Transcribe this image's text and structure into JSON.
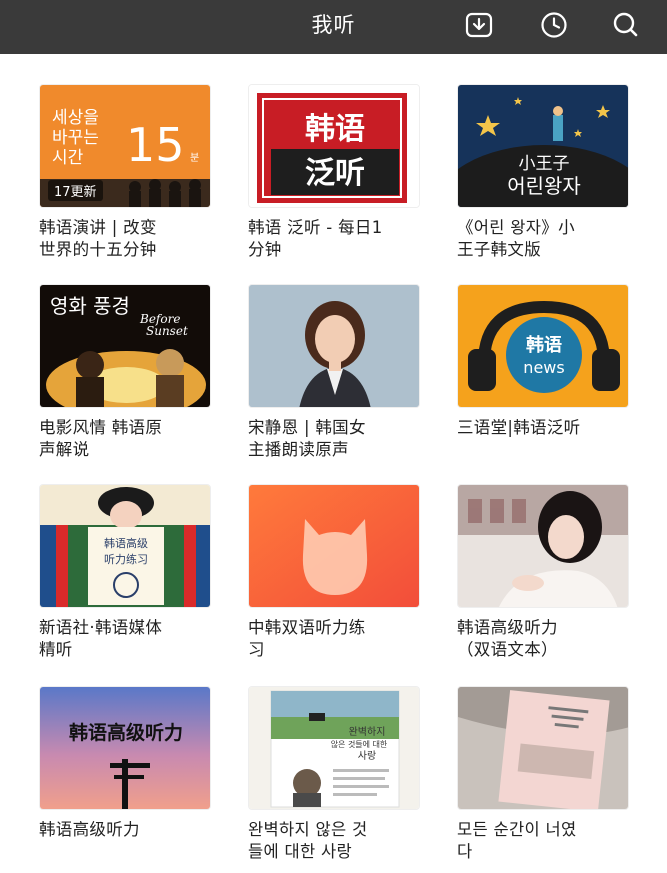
{
  "header": {
    "title": "我听",
    "icons": [
      "download-icon",
      "history-icon",
      "search-icon"
    ],
    "background": "#3a3a3a"
  },
  "items": [
    {
      "title": "韩语演讲 | 改变\n世界的十五分钟",
      "badge": "17更新",
      "cover_text": [
        "세상을",
        "바꾸는",
        "시간",
        "15",
        "분"
      ]
    },
    {
      "title": "韩语 泛听 - 每日1\n分钟",
      "cover_text": [
        "韩语",
        "泛听"
      ]
    },
    {
      "title": "《어린 왕자》小\n王子韩文版",
      "cover_text": [
        "小王子",
        "어린왕자"
      ]
    },
    {
      "title": "电影风情 韩语原\n声解说",
      "cover_text": [
        "영화 풍경",
        "Before",
        "Sunset"
      ]
    },
    {
      "title": "宋静恩 | 韩国女\n主播朗读原声"
    },
    {
      "title": "三语堂|韩语泛听",
      "cover_text": [
        "韩语",
        "news"
      ]
    },
    {
      "title": "新语社·韩语媒体\n精听",
      "cover_text": [
        "韩语高级",
        "听力练习"
      ]
    },
    {
      "title": "中韩双语听力练\n习"
    },
    {
      "title": "韩语高级听力\n（双语文本）"
    },
    {
      "title": "韩语高级听力",
      "cover_text": [
        "韩语高级听力"
      ]
    },
    {
      "title": "완벽하지 않은 것\n들에 대한 사랑",
      "cover_text": [
        "완벽하지",
        "않은 것들에 대한",
        "사랑"
      ]
    },
    {
      "title": "모든 순간이 너였\n다"
    }
  ]
}
